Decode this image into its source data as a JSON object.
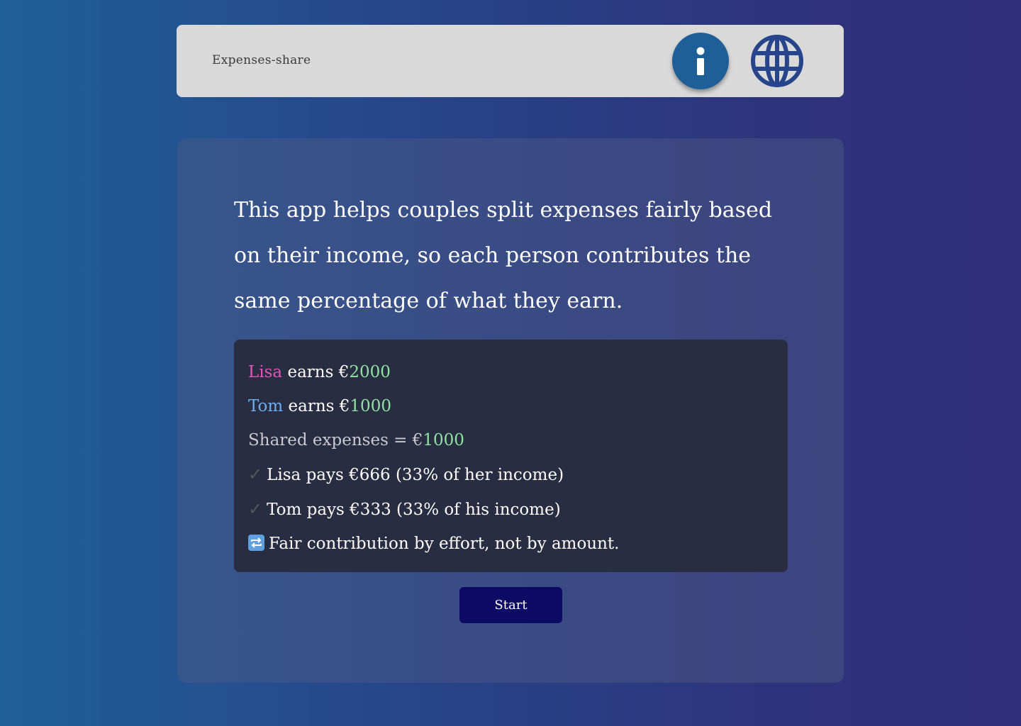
{
  "header": {
    "app_title": "Expenses-share",
    "info_icon": "info-icon",
    "language_icon": "globe-icon",
    "info_color": "#1e5f98",
    "globe_color": "#27458a"
  },
  "main": {
    "intro": "This app helps couples split expenses fairly based on their income, so each person contributes the same percentage of what they earn.",
    "example": {
      "lisa_name": "Lisa",
      "lisa_earns_text": " earns €",
      "lisa_amount": "2000",
      "tom_name": "Tom",
      "tom_earns_text": " earns €",
      "tom_amount": "1000",
      "shared_text": "Shared expenses = €",
      "shared_amount": "1000",
      "check_symbol": "✓",
      "lisa_pays": "Lisa pays €666 (33% of her income)",
      "tom_pays": "Tom pays €333 (33% of his income)",
      "repeat_icon": "repeat-icon",
      "fair_text": "Fair contribution by effort, not by amount."
    },
    "start_label": "Start"
  },
  "colors": {
    "lisa": "#e256b6",
    "tom": "#6ab0f5",
    "money": "#8fe3a0",
    "start_button": "#0d0a66"
  }
}
